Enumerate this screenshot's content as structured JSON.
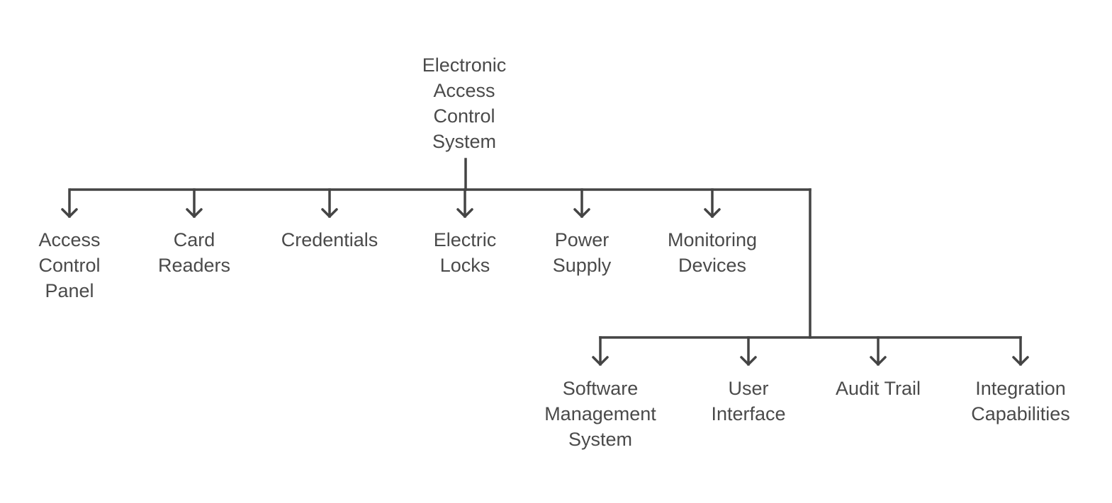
{
  "colors": {
    "line": "#444444",
    "text": "#4a4a4a",
    "background": "#ffffff"
  },
  "root": {
    "id": "root",
    "label": "Electronic\nAccess\nControl\nSystem"
  },
  "level1": [
    {
      "id": "access-control-panel",
      "label": "Access\nControl\nPanel"
    },
    {
      "id": "card-readers",
      "label": "Card\nReaders"
    },
    {
      "id": "credentials",
      "label": "Credentials"
    },
    {
      "id": "electric-locks",
      "label": "Electric\nLocks"
    },
    {
      "id": "power-supply",
      "label": "Power\nSupply"
    },
    {
      "id": "monitoring-devices",
      "label": "Monitoring\nDevices"
    }
  ],
  "level2": [
    {
      "id": "software-management-system",
      "label": "Software\nManagement\nSystem"
    },
    {
      "id": "user-interface",
      "label": "User\nInterface"
    },
    {
      "id": "audit-trail",
      "label": "Audit Trail"
    },
    {
      "id": "integration-capabilities",
      "label": "Integration\nCapabilities"
    }
  ],
  "edges": [
    [
      "root",
      "access-control-panel"
    ],
    [
      "root",
      "card-readers"
    ],
    [
      "root",
      "credentials"
    ],
    [
      "root",
      "electric-locks"
    ],
    [
      "root",
      "power-supply"
    ],
    [
      "root",
      "monitoring-devices"
    ],
    [
      "root",
      "software-management-system"
    ],
    [
      "root",
      "user-interface"
    ],
    [
      "root",
      "audit-trail"
    ],
    [
      "root",
      "integration-capabilities"
    ]
  ]
}
